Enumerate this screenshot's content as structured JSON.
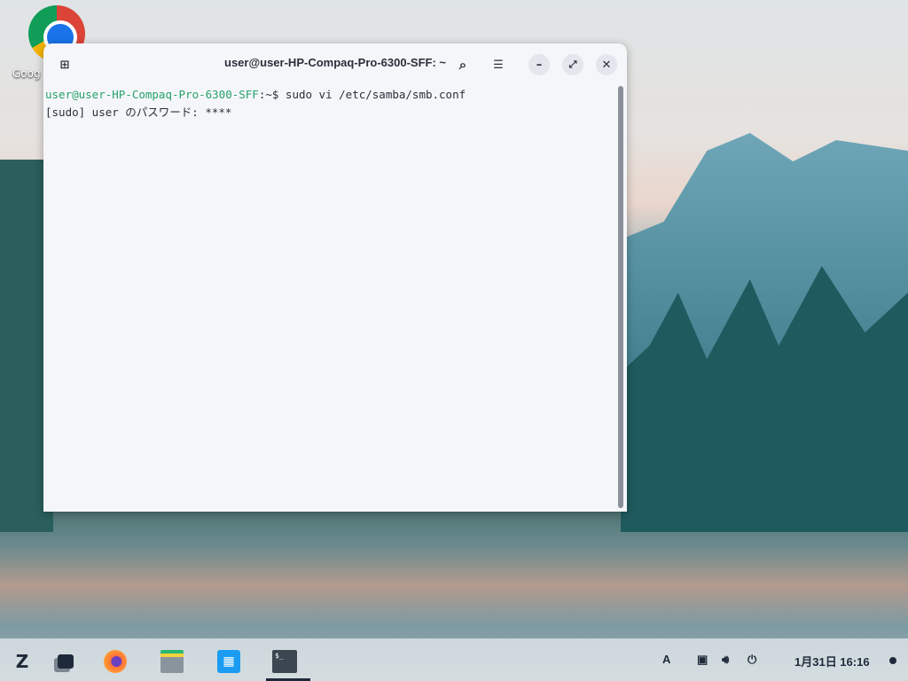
{
  "desktop": {
    "icons": [
      {
        "label": "Google Chrome",
        "visible_label": "Goog"
      }
    ]
  },
  "terminal": {
    "title": "user@user-HP-Compaq-Pro-6300-SFF: ~",
    "lines": [
      {
        "prompt": "user@user-HP-Compaq-Pro-6300-SFF",
        "path": ":~$",
        "command": " sudo vi /etc/samba/smb.conf"
      },
      {
        "text": "[sudo] user のパスワード: ****"
      }
    ]
  },
  "taskbar": {
    "apps": [
      "Zorin menu",
      "Workspaces",
      "Firefox",
      "Files",
      "Software",
      "Terminal"
    ],
    "tray": {
      "keyboard": "A",
      "clock": "1月31日 16:16"
    }
  }
}
